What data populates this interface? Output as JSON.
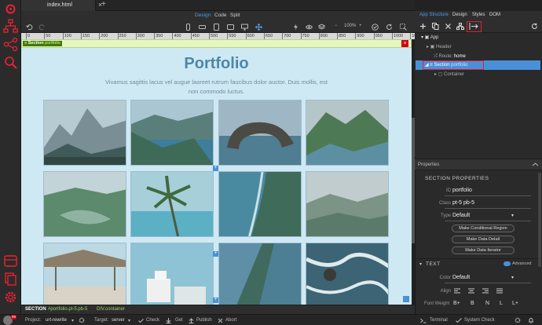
{
  "tab": {
    "title": "index.html",
    "close": "×",
    "add": "+"
  },
  "modes": {
    "design": "Design",
    "code": "Code",
    "split": "Split"
  },
  "zoom": {
    "minus": "−",
    "value": "100%",
    "plus": "+"
  },
  "ruler": [
    "0",
    "50",
    "100",
    "150",
    "200",
    "250",
    "300",
    "350",
    "400",
    "450",
    "500",
    "550",
    "600",
    "650",
    "700",
    "750",
    "800",
    "850",
    "900",
    "950",
    "1000",
    "1050"
  ],
  "section": {
    "tag": "Section",
    "id": "portfolio",
    "close": "×"
  },
  "page": {
    "title": "Portfolio",
    "desc": "Vivamus sagittis lacus vel augue laoreet rutrum faucibus dolor auctor. Duis mollis, est non commodo luctus."
  },
  "panel": {
    "tabs": [
      "App Structure",
      "Design",
      "Styles",
      "DOM"
    ],
    "tree": {
      "app": "App",
      "header": "Header",
      "route": "Route:",
      "route_val": "home",
      "section": "Section",
      "section_id": "portfolio",
      "container": "Container"
    },
    "properties": "Properties",
    "section_props": "SECTION PROPERTIES",
    "id_label": "ID",
    "id_val": "portfolio",
    "class_label": "Class",
    "class_val": "pt-5 pb-5",
    "type_label": "Type",
    "type_val": "Default",
    "btns": [
      "Make Conditional Region",
      "Make Data Detail",
      "Make Data Iterator"
    ],
    "text_head": "TEXT",
    "advanced": "Advanced",
    "color_label": "Color",
    "color_val": "Default",
    "align_label": "Align",
    "weight_label": "Font Weight",
    "weights": [
      "B+",
      "B",
      "N",
      "L",
      "L+"
    ]
  },
  "breadcrumb": {
    "section": "SECTION",
    "section_rest": "#portfolio.pt-5.pb-5",
    "div": "DIV.container"
  },
  "statusbar": {
    "project_label": "Project:",
    "project": "urt-rewrite",
    "target_label": "Target:",
    "target": "server",
    "check": "Check",
    "get": "Get",
    "publish": "Publish",
    "abort": "Abort",
    "terminal": "Terminal",
    "system_check": "System Check",
    "avatar_badge": "99"
  },
  "colors": {
    "accent": "#4a90d9",
    "highlight": "#e02030",
    "canvas": "#cfe9f4",
    "section_bar": "#e5f7c1"
  }
}
